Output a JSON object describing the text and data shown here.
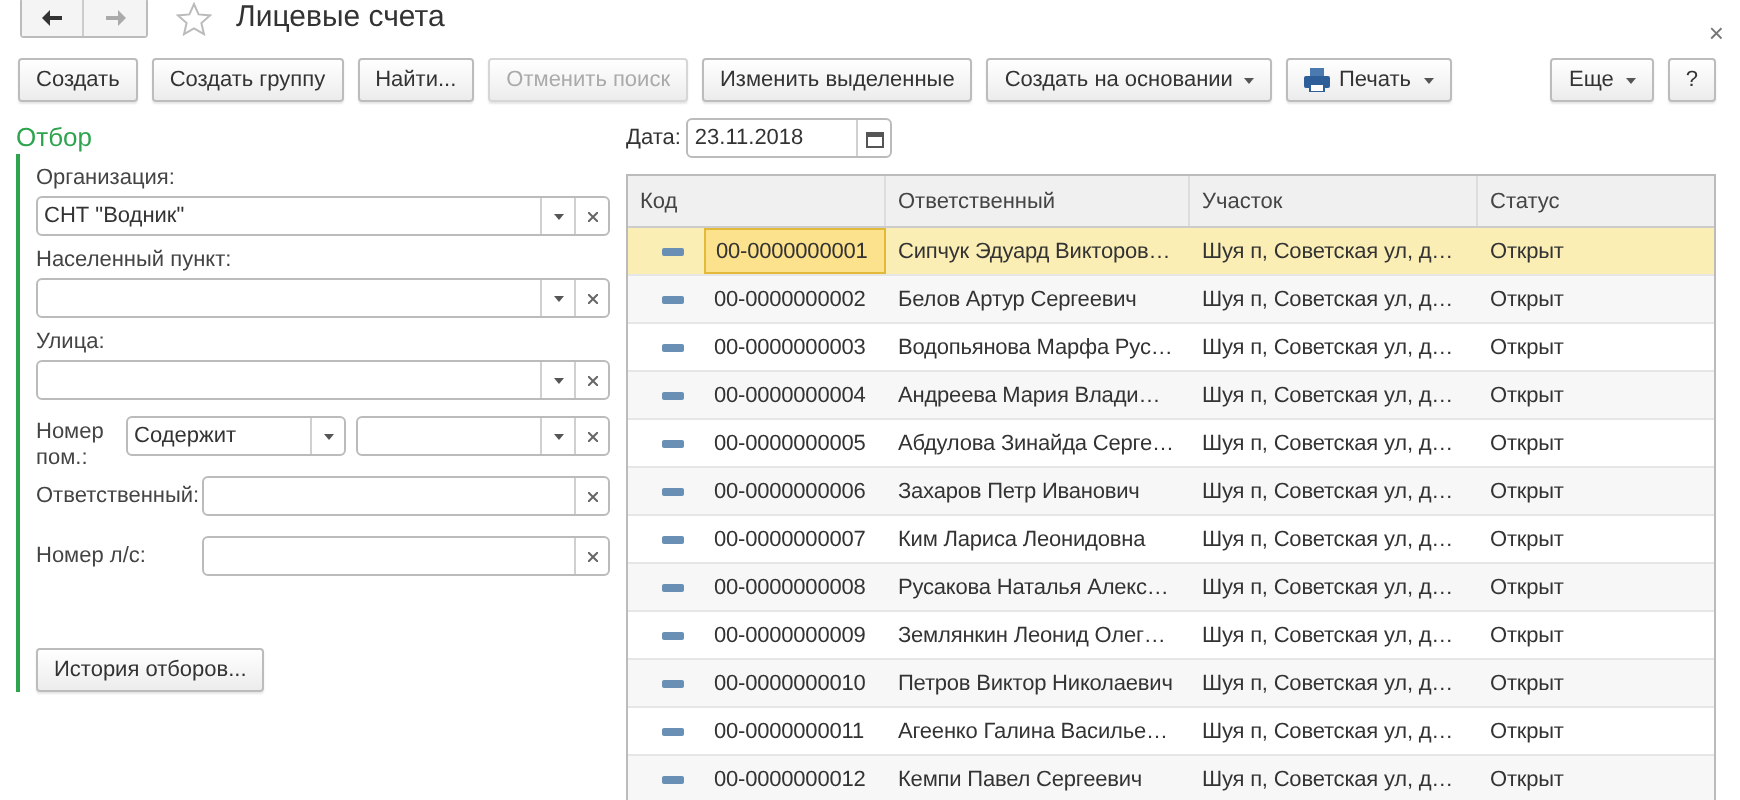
{
  "window": {
    "title": "Лицевые счета",
    "favorite": false,
    "close": "×"
  },
  "toolbar": [
    {
      "label": "Создать",
      "kind": "plain",
      "disabled": false
    },
    {
      "label": "Создать группу",
      "kind": "plain",
      "disabled": false
    },
    {
      "label": "Найти...",
      "kind": "plain",
      "disabled": false
    },
    {
      "label": "Отменить поиск",
      "kind": "plain",
      "disabled": true
    },
    {
      "label": "Изменить выделенные",
      "kind": "plain",
      "disabled": false
    },
    {
      "label": "Создать на основании",
      "kind": "menu",
      "disabled": false
    },
    {
      "label": "Печать",
      "kind": "print-menu",
      "disabled": false
    }
  ],
  "toolbar_right": [
    {
      "label": "Еще",
      "kind": "menu",
      "disabled": false
    },
    {
      "label": "?",
      "kind": "plain",
      "disabled": false
    }
  ],
  "filter": {
    "title": "Отбор",
    "fields": [
      {
        "kind": "combo",
        "label": "Организация:",
        "value": "СНТ \"Водник\""
      },
      {
        "kind": "combo",
        "label": "Населенный пункт:"
      },
      {
        "kind": "combo",
        "label": "Улица:"
      },
      {
        "kind": "condition",
        "label": "Номер пом.:",
        "condition": "Содержит"
      },
      {
        "kind": "text",
        "label": "Ответственный:"
      },
      {
        "kind": "text",
        "label": "Номер л/с:"
      }
    ],
    "history_button": "История отборов..."
  },
  "date": {
    "label": "Дата:",
    "value": "23.11.2018"
  },
  "table": {
    "columns": [
      "Код",
      "Ответственный",
      "Участок",
      "Статус"
    ],
    "rows": [
      {
        "selected": true,
        "cells": [
          "00-0000000001",
          "Сипчук Эдуард Викторов…",
          "Шуя п, Советская ул, д…",
          "Открыт"
        ]
      },
      {
        "selected": false,
        "cells": [
          "00-0000000002",
          "Белов Артур Сергеевич",
          "Шуя п, Советская ул, д…",
          "Открыт"
        ]
      },
      {
        "selected": false,
        "cells": [
          "00-0000000003",
          "Водопьянова Марфа Рус…",
          "Шуя п, Советская ул, д…",
          "Открыт"
        ]
      },
      {
        "selected": false,
        "cells": [
          "00-0000000004",
          "Андреева Мария Влади…",
          "Шуя п, Советская ул, д…",
          "Открыт"
        ]
      },
      {
        "selected": false,
        "cells": [
          "00-0000000005",
          "Абдулова Зинайда Серге…",
          "Шуя п, Советская ул, д…",
          "Открыт"
        ]
      },
      {
        "selected": false,
        "cells": [
          "00-0000000006",
          "Захаров Петр Иванович",
          "Шуя п, Советская ул, д…",
          "Открыт"
        ]
      },
      {
        "selected": false,
        "cells": [
          "00-0000000007",
          "Ким Лариса Леонидовна",
          "Шуя п, Советская ул, д…",
          "Открыт"
        ]
      },
      {
        "selected": false,
        "cells": [
          "00-0000000008",
          "Русакова Наталья Алекс…",
          "Шуя п, Советская ул, д…",
          "Открыт"
        ]
      },
      {
        "selected": false,
        "cells": [
          "00-0000000009",
          "Землянкин Леонид Олег…",
          "Шуя п, Советская ул, д…",
          "Открыт"
        ]
      },
      {
        "selected": false,
        "cells": [
          "00-0000000010",
          "Петров Виктор Николаевич",
          "Шуя п, Советская ул, д…",
          "Открыт"
        ]
      },
      {
        "selected": false,
        "cells": [
          "00-0000000011",
          "Агеенко Галина Василье…",
          "Шуя п, Советская ул, д…",
          "Открыт"
        ]
      },
      {
        "selected": false,
        "cells": [
          "00-0000000012",
          "Кемпи Павел Сергеевич",
          "Шуя п, Советская ул, д…",
          "Открыт"
        ]
      }
    ]
  }
}
